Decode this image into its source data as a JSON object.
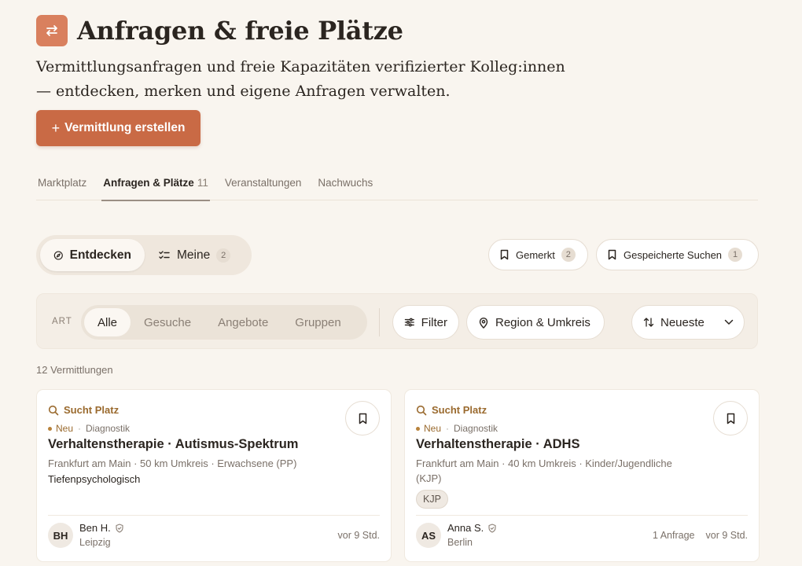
{
  "header": {
    "title": "Anfragen & freie Plätze",
    "subtitle": "Vermittlungsanfragen und freie Kapazitäten verifizierter Kolleg:innen — entdecken, merken und eigene Anfragen verwalten.",
    "create_button": "Vermittlung erstellen",
    "create_button_plus": "+"
  },
  "tabs": [
    {
      "label": "Marktplatz",
      "count": ""
    },
    {
      "label": "Anfragen & Plätze",
      "count": "11"
    },
    {
      "label": "Veranstaltungen",
      "count": ""
    },
    {
      "label": "Nachwuchs",
      "count": ""
    }
  ],
  "view_switch": {
    "discover_label": "Entdecken",
    "mine_label": "Meine",
    "mine_count": "2"
  },
  "saved": {
    "bookmarked_label": "Gemerkt",
    "bookmarked_count": "2",
    "saved_searches_label": "Gespeicherte Suchen",
    "saved_searches_count": "1"
  },
  "filters": {
    "art_label": "ART",
    "types": [
      "Alle",
      "Gesuche",
      "Angebote",
      "Gruppen"
    ],
    "selected_type": "Alle",
    "filter_label": "Filter",
    "region_label": "Region & Umkreis",
    "sort_label": "Neueste"
  },
  "results": {
    "count_text": "12 Vermittlungen"
  },
  "cards": [
    {
      "type": "Sucht Platz",
      "new_label": "Neu",
      "category": "Diagnostik",
      "title": "Verhaltenstherapie · Autismus-Spektrum",
      "location": "Frankfurt am Main · 50 km Umkreis · Erwachsene (PP)",
      "extra": "Tiefenpsychologisch",
      "tag": "",
      "author_initials": "BH",
      "author_name": "Ben H.",
      "author_city": "Leipzig",
      "requests": "",
      "time": "vor 9 Std."
    },
    {
      "type": "Sucht Platz",
      "new_label": "Neu",
      "category": "Diagnostik",
      "title": "Verhaltenstherapie · ADHS",
      "location": "Frankfurt am Main · 40 km Umkreis · Kinder/Jugendliche (KJP)",
      "extra": "",
      "tag": "KJP",
      "author_initials": "AS",
      "author_name": "Anna S.",
      "author_city": "Berlin",
      "requests": "1 Anfrage",
      "time": "vor 9 Std."
    }
  ],
  "colors": {
    "background": "#f9f5ef",
    "accent": "#c96a45",
    "type_label": "#9a6a2e"
  }
}
